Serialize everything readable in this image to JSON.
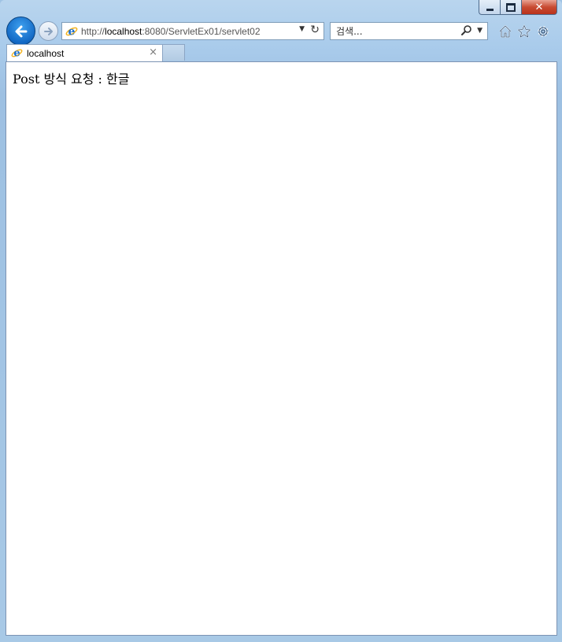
{
  "window": {
    "controls": {
      "minimize": "minimize",
      "maximize": "maximize",
      "close": "close"
    }
  },
  "nav": {
    "address": {
      "url_prefix": "http://",
      "url_host": "localhost",
      "url_rest": ":8080/ServletEx01/servlet02"
    },
    "search": {
      "placeholder": "검색..."
    }
  },
  "tabs": [
    {
      "label": "localhost",
      "close": "×"
    }
  ],
  "content": {
    "message": "Post 방식 요청 : 한글"
  },
  "colors": {
    "back_button": "#1268c4",
    "close_button": "#c84b32",
    "frame": "#a9cbeb"
  },
  "icons": {
    "back": "arrow-left-icon",
    "forward": "arrow-right-icon",
    "refresh": "refresh-icon",
    "search": "magnifier-icon",
    "home": "home-icon",
    "favorites": "star-icon",
    "tools": "gear-icon"
  }
}
